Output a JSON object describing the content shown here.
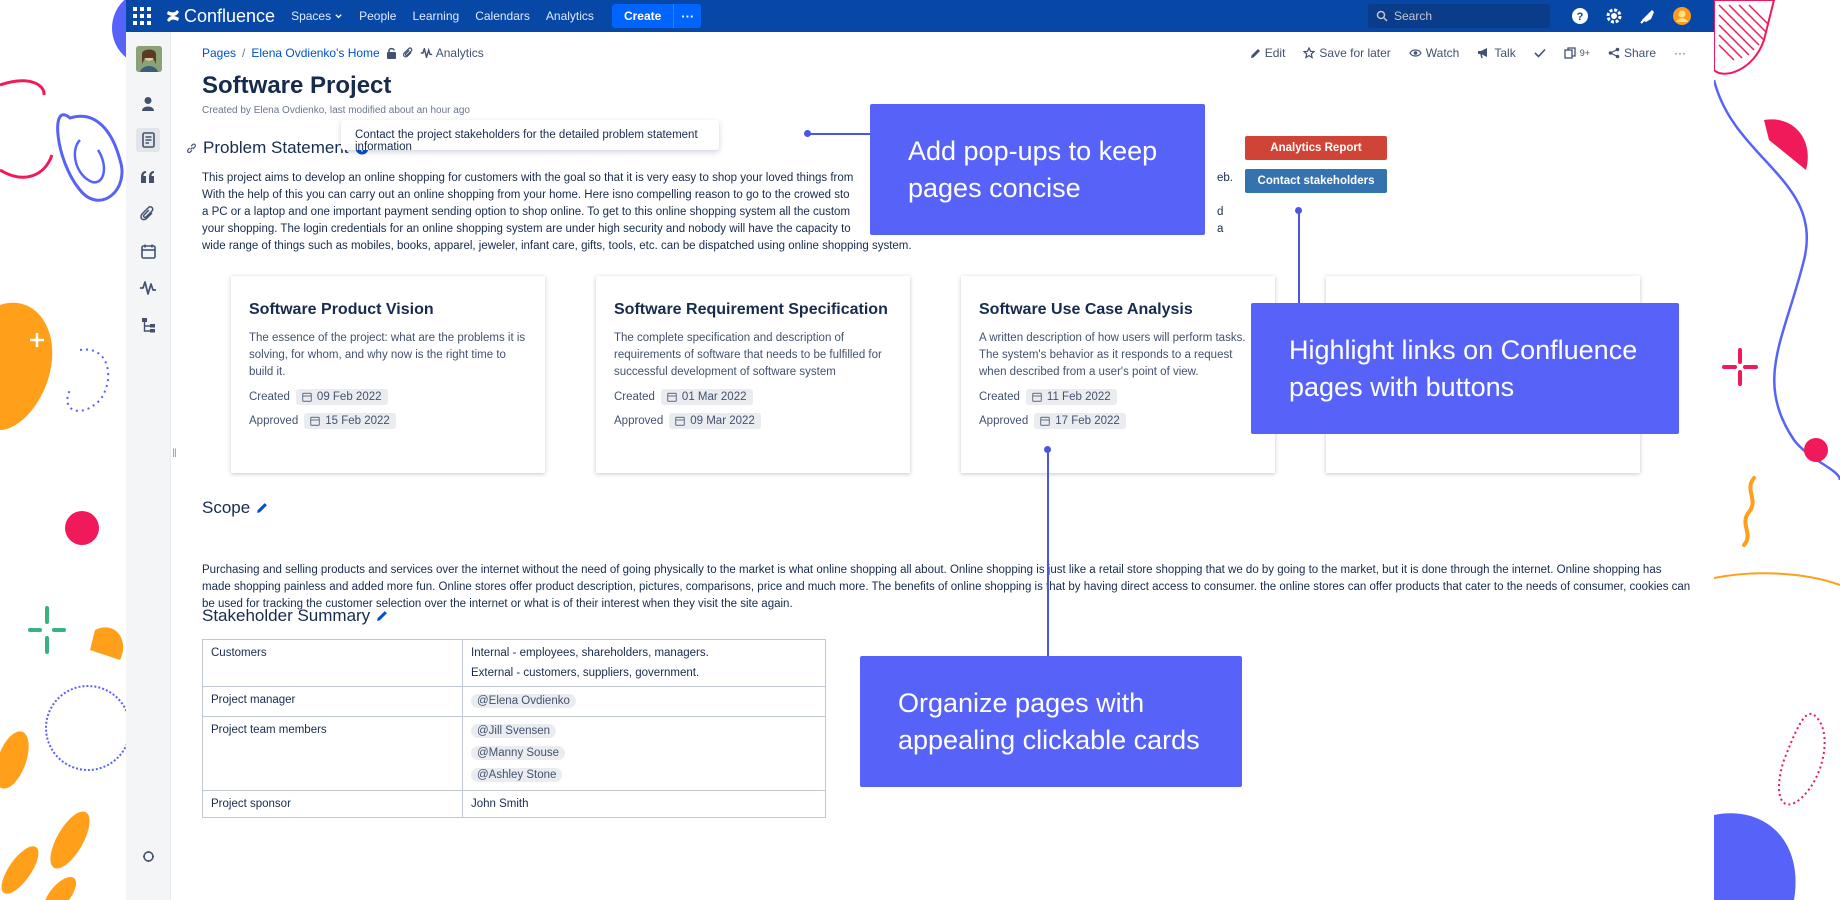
{
  "topnav": {
    "logo": "Confluence",
    "items": [
      "Spaces",
      "People",
      "Learning",
      "Calendars",
      "Analytics"
    ],
    "create_label": "Create",
    "more_label": "···",
    "search_placeholder": "Search"
  },
  "breadcrumb": {
    "pages": "Pages",
    "separator": "/",
    "home": "Elena Ovdienko's Home",
    "analytics": "Analytics"
  },
  "page_actions": [
    "Edit",
    "Save for later",
    "Watch",
    "Talk",
    "9+",
    "Share",
    "···"
  ],
  "page": {
    "title": "Software Project",
    "byline": "Created by Elena Ovdienko, last modified about an hour ago"
  },
  "problem": {
    "heading": "Problem Statement",
    "popup_text": "Contact the project stakeholders for the detailed problem statement information",
    "lines": [
      "This project aims to develop an online shopping for customers with the goal so that it is very easy to shop your loved things from",
      "With the help of this you can carry out an online shopping from your home. Here isno compelling reason to go to the crowed sto",
      "a PC or a laptop and one important payment sending option to shop online. To get to this online shopping system all the custom",
      "your shopping. The login credentials for an online shopping system are under high security and nobody will have the capacity to",
      "wide range of things such as mobiles, books, apparel, jeweler, infant care, gifts, tools, etc. can be dispatched using online shopping system."
    ],
    "right_fragments": [
      "eb.",
      "d",
      "a"
    ]
  },
  "buttons": {
    "analytics_report": "Analytics Report",
    "contact_stakeholders": "Contact stakeholders"
  },
  "cards": [
    {
      "title": "Software Product Vision",
      "desc": "The essence of the project: what are the problems it is solving, for whom, and why now is the right time to build it.",
      "created_label": "Created",
      "created": "09 Feb 2022",
      "approved_label": "Approved",
      "approved": "15 Feb 2022"
    },
    {
      "title": "Software Requirement Specification",
      "desc": "The complete specification and description of requirements of software that needs to be fulfilled for successful development of software system",
      "created_label": "Created",
      "created": "01 Mar 2022",
      "approved_label": "Approved",
      "approved": "09 Mar 2022"
    },
    {
      "title": "Software Use Case Analysis",
      "desc": "A written description of how users will perform tasks. The system's behavior as it responds to a request when described from a user's point of view.",
      "created_label": "Created",
      "created": "11 Feb 2022",
      "approved_label": "Approved",
      "approved": "17 Feb 2022"
    }
  ],
  "scope": {
    "heading": "Scope",
    "text": "Purchasing and selling products and services over the internet without the need of going physically to the market is what online shopping all about. Online shopping is just like a retail store shopping that we do by going to the market, but it is done through the internet. Online shopping has made shopping painless and added more fun. Online stores offer product description, pictures, comparisons, price and much more. The benefits of online shopping is that by having direct access to consumer. the online stores can offer products that cater to the needs of consumer, cookies can be used for tracking the customer selection over the internet or what is of their interest when they visit the site again."
  },
  "stakeholders": {
    "heading": "Stakeholder Summary",
    "rows": [
      {
        "role": "Customers",
        "lines": [
          "Internal - employees, shareholders, managers.",
          "External - customers, suppliers, government."
        ]
      },
      {
        "role": "Project manager",
        "mentions": [
          "@Elena Ovdienko"
        ]
      },
      {
        "role": "Project team members",
        "mentions": [
          "@Jill Svensen",
          "@Manny Souse",
          "@Ashley Stone"
        ]
      },
      {
        "role": "Project sponsor",
        "lines": [
          "John Smith"
        ]
      }
    ]
  },
  "callouts": {
    "popups": "Add pop-ups to keep pages concise",
    "buttons": "Highlight links on Confluence pages with buttons",
    "cards": "Organize pages with appealing clickable cards"
  },
  "colors": {
    "nav": "#0747a6",
    "create": "#0065ff",
    "callout": "#5762f8",
    "btn_red": "#d04437",
    "btn_blue": "#3572b0"
  },
  "icons": [
    "apps-grid-icon",
    "confluence-logo-icon",
    "search-icon",
    "help-icon",
    "settings-icon",
    "notifications-icon",
    "user-avatar-icon",
    "info-icon",
    "link-icon",
    "pencil-icon",
    "calendar-icon"
  ]
}
